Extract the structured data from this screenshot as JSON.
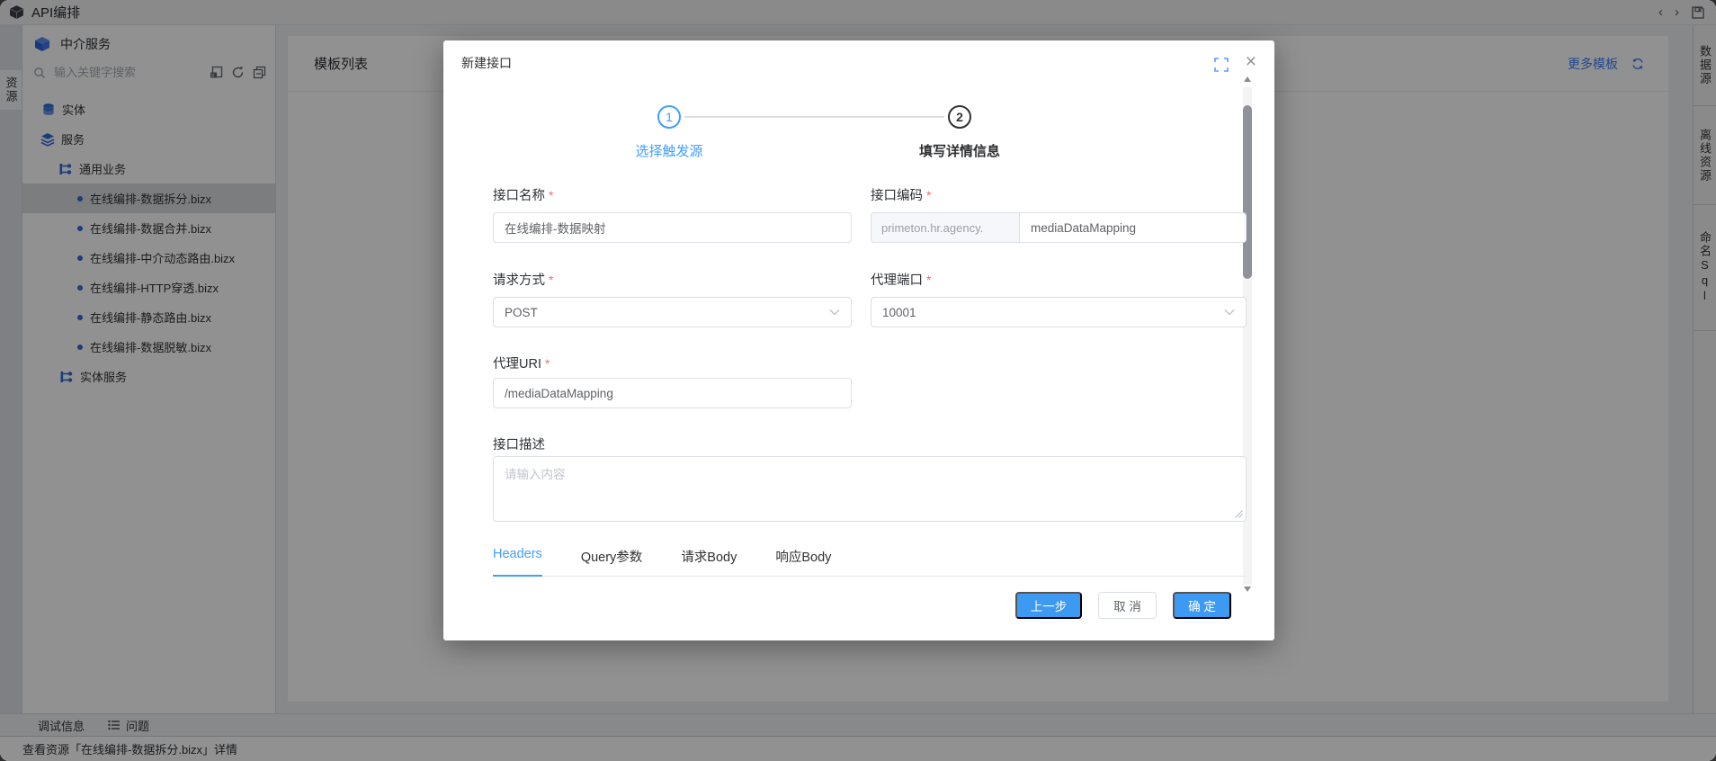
{
  "titlebar": {
    "app_title": "API编排"
  },
  "left_strip": {
    "resources_tab": "资源"
  },
  "sidebar": {
    "header_title": "中介服务",
    "search_placeholder": "输入关键字搜索",
    "tree": [
      {
        "label": "实体"
      },
      {
        "label": "服务"
      },
      {
        "label": "通用业务"
      },
      {
        "label": "在线编排-数据拆分.bizx",
        "selected": true
      },
      {
        "label": "在线编排-数据合并.bizx"
      },
      {
        "label": "在线编排-中介动态路由.bizx"
      },
      {
        "label": "在线编排-HTTP穿透.bizx"
      },
      {
        "label": "在线编排-静态路由.bizx"
      },
      {
        "label": "在线编排-数据脱敏.bizx"
      },
      {
        "label": "实体服务"
      }
    ]
  },
  "main": {
    "panel_title": "模板列表",
    "more_templates_label": "更多模板"
  },
  "right_strip": {
    "tabs": [
      {
        "label": "数据源"
      },
      {
        "label": "离线资源"
      },
      {
        "label": "命名Sql"
      }
    ]
  },
  "bottom_bar": {
    "debug_tab": "调试信息",
    "problems_tab": "问题",
    "status_text": "查看资源「在线编排-数据拆分.bizx」详情"
  },
  "modal": {
    "title": "新建接口",
    "required_mark": "*",
    "steps": [
      {
        "number": "1",
        "label": "选择触发源"
      },
      {
        "number": "2",
        "label": "填写详情信息"
      }
    ],
    "form": {
      "name_label": "接口名称",
      "name_value": "在线编排-数据映射",
      "code_label": "接口编码",
      "code_prefix": "primeton.hr.agency.",
      "code_value": "mediaDataMapping",
      "method_label": "请求方式",
      "method_value": "POST",
      "port_label": "代理端口",
      "port_value": "10001",
      "uri_label": "代理URI",
      "uri_value": "/mediaDataMapping",
      "desc_label": "接口描述",
      "desc_placeholder": "请输入内容"
    },
    "tabs": [
      {
        "label": "Headers"
      },
      {
        "label": "Query参数"
      },
      {
        "label": "请求Body"
      },
      {
        "label": "响应Body"
      }
    ],
    "footer": {
      "prev_label": "上一步",
      "cancel_label": "取 消",
      "confirm_label": "确 定"
    }
  },
  "colors": {
    "accent_blue": "#3d9af2",
    "step_blue": "#409eff",
    "link_blue": "#3d7fff",
    "required_red": "#f56c6c",
    "selected_row": "#d9dce0"
  }
}
